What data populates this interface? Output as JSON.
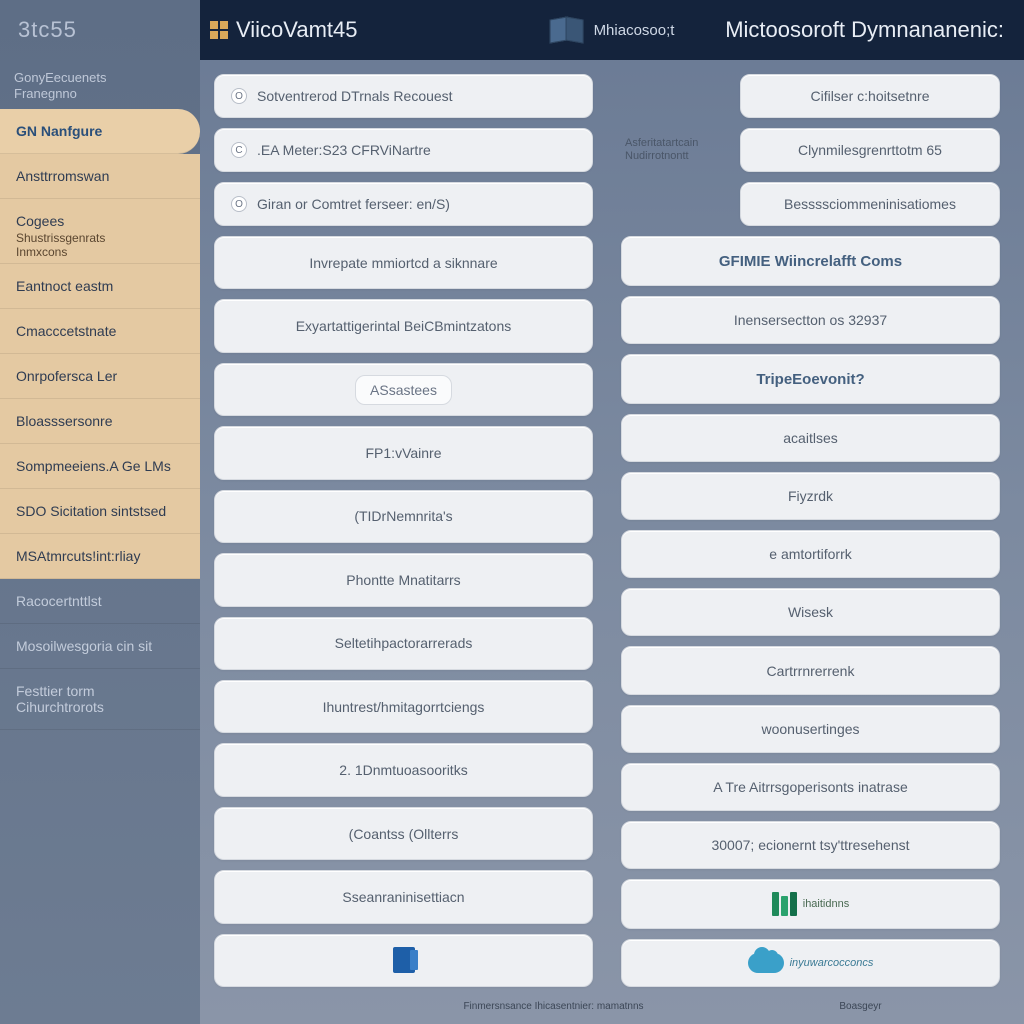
{
  "sidebar": {
    "top_label": "3tc55",
    "subhead_line1": "GonyEecuenets",
    "subhead_line2": "Franegnno",
    "items": [
      {
        "label": "GN Nanfgure",
        "active": true
      },
      {
        "label": "Ansttrromswan"
      },
      {
        "label": "Cogees"
      },
      {
        "label_sub1": "Shustrissgenrats"
      },
      {
        "label_sub2": "Inmxcons"
      },
      {
        "label": "Eantnoct eastm"
      },
      {
        "label": "Cmacccetstnate"
      },
      {
        "label": "Onrpofersca Ler"
      },
      {
        "label": "Bloasssersonre"
      },
      {
        "label": "Sompmeeiens.A Ge LMs"
      },
      {
        "label": "SDO Sicitation sintstsed"
      },
      {
        "label": "MSAtmrcuts!int:rliay"
      },
      {
        "label": "Racocertnttlst",
        "dim": true
      },
      {
        "label": "Mosoilwesgoria cin sit",
        "dim": true
      },
      {
        "label": "Festtier torm Cihurchtrorots",
        "dim": true
      }
    ]
  },
  "header": {
    "left_title": "ViicoVamt45",
    "center_label": "Mhiacosoo;t",
    "right_title": "Mictoosoroft Dymnananenic:"
  },
  "columns": {
    "left": [
      {
        "bullet": "O",
        "label": "Sotventrerod DTrnals Recouest",
        "mini": ""
      },
      {
        "bullet": "C",
        "label": ".EA Meter:S23 CFRViNartre",
        "mini": ""
      },
      {
        "bullet": "O",
        "label": "Giran or Comtret ferseer: en/S)",
        "mini": ""
      },
      {
        "label": "Invrepate mmiortcd a siknnare"
      },
      {
        "label": "Exyartattigerintal BeiCBmintzatons"
      },
      {
        "chip": "ASsastees"
      },
      {
        "label": "FP1:vVainre"
      },
      {
        "label": "(TIDrNemnrita's"
      },
      {
        "label": "Phontte Mnatitarrs"
      },
      {
        "label": "Seltetihpactorarrerads"
      },
      {
        "label": "Ihuntrest/hmitagorrtciengs"
      },
      {
        "label": "2. 1Dnmtuoasooritks"
      },
      {
        "label": "(Coantss (Ollterrs"
      },
      {
        "label": "Sseanraninisettiacn"
      },
      {
        "icon": "box"
      }
    ],
    "right": [
      {
        "label": "Cifilser c:hoitsetnre",
        "mini": ""
      },
      {
        "label": "Clynmilesgrenrttotm 65",
        "mini": "Asferitatartcain Nudirrotnontt"
      },
      {
        "label": "Bessssciommeninisatiomes",
        "mini": ""
      },
      {
        "label": "GFIMIE Wiincrelafft Coms",
        "tall": true
      },
      {
        "label": "Inensersectton os 32937"
      },
      {
        "label": "TripeEoevonit?",
        "tall": true
      },
      {
        "label": "acaitlses"
      },
      {
        "label": "Fiyzrdk"
      },
      {
        "label": "e amtortiforrk"
      },
      {
        "label": "Wisesk"
      },
      {
        "label": "Cartrrnrerrenk"
      },
      {
        "label": "woonusertinges"
      },
      {
        "label": "A Tre Aitrrsgoperisonts inatrase"
      },
      {
        "label": "30007; ecionernt tsy'ttresehenst"
      },
      {
        "icon": "books",
        "icon_label": "ihaitidnns"
      },
      {
        "icon": "cloud",
        "icon_label": "inyuwarcocconcs"
      }
    ]
  },
  "footers": {
    "left": "Finmersnsance Ihicasentnier: mamatnns",
    "right": "Boasgeyr"
  }
}
